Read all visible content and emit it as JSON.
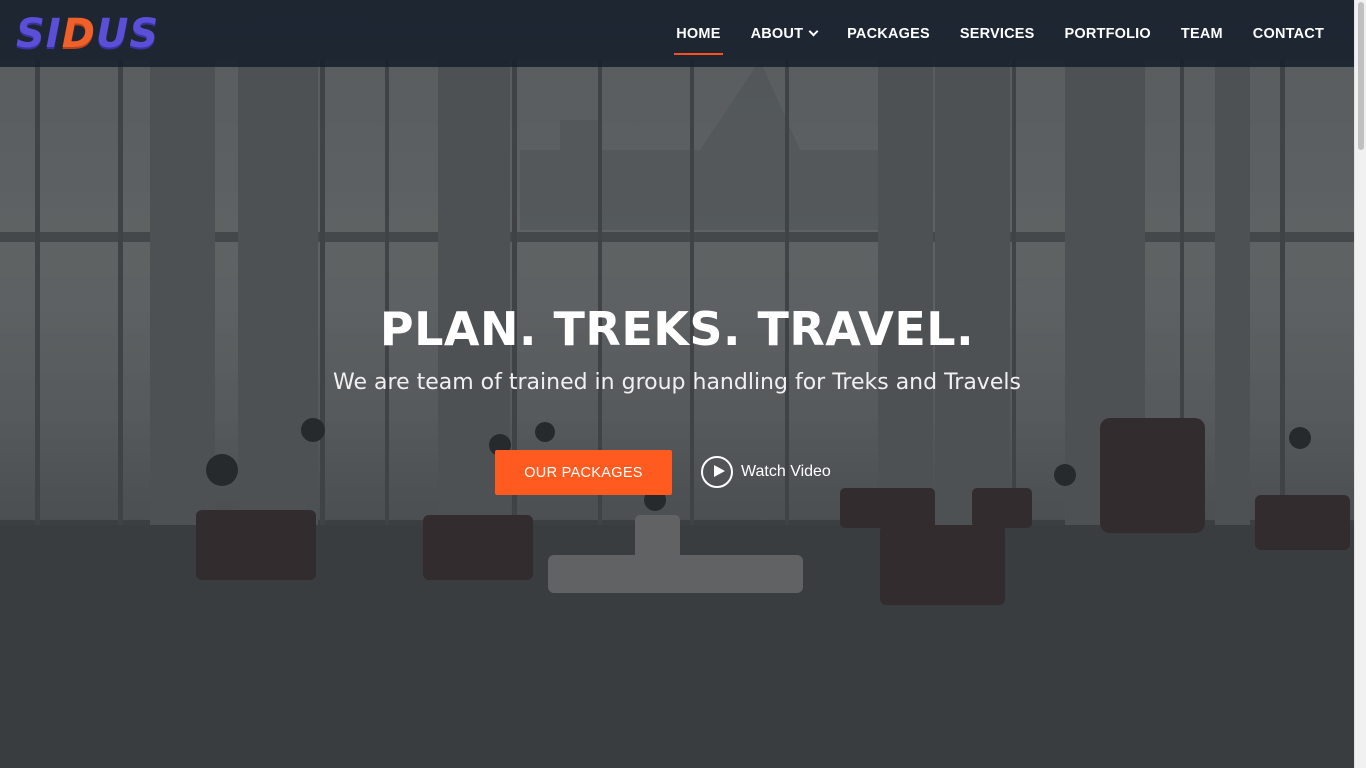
{
  "brand": {
    "logo_text_1": "SI",
    "logo_text_2": "D",
    "logo_text_3": "US",
    "primary_color": "#5a4fd6",
    "accent_color": "#f0602a"
  },
  "nav": {
    "items": [
      {
        "label": "HOME",
        "active": true
      },
      {
        "label": "ABOUT",
        "has_dropdown": true
      },
      {
        "label": "PACKAGES"
      },
      {
        "label": "SERVICES"
      },
      {
        "label": "PORTFOLIO"
      },
      {
        "label": "TEAM"
      },
      {
        "label": "CONTACT"
      }
    ],
    "active_color": "#ff4f1f"
  },
  "hero": {
    "title": "PLAN. TREKS. TRAVEL.",
    "subtitle": "We are team of trained in group handling for Treks and Travels",
    "cta_label": "OUR PACKAGES",
    "cta_color": "#ff5a1f",
    "video_label": "Watch Video",
    "video_icon": "play-circle-icon",
    "background": "atrium-photo"
  }
}
